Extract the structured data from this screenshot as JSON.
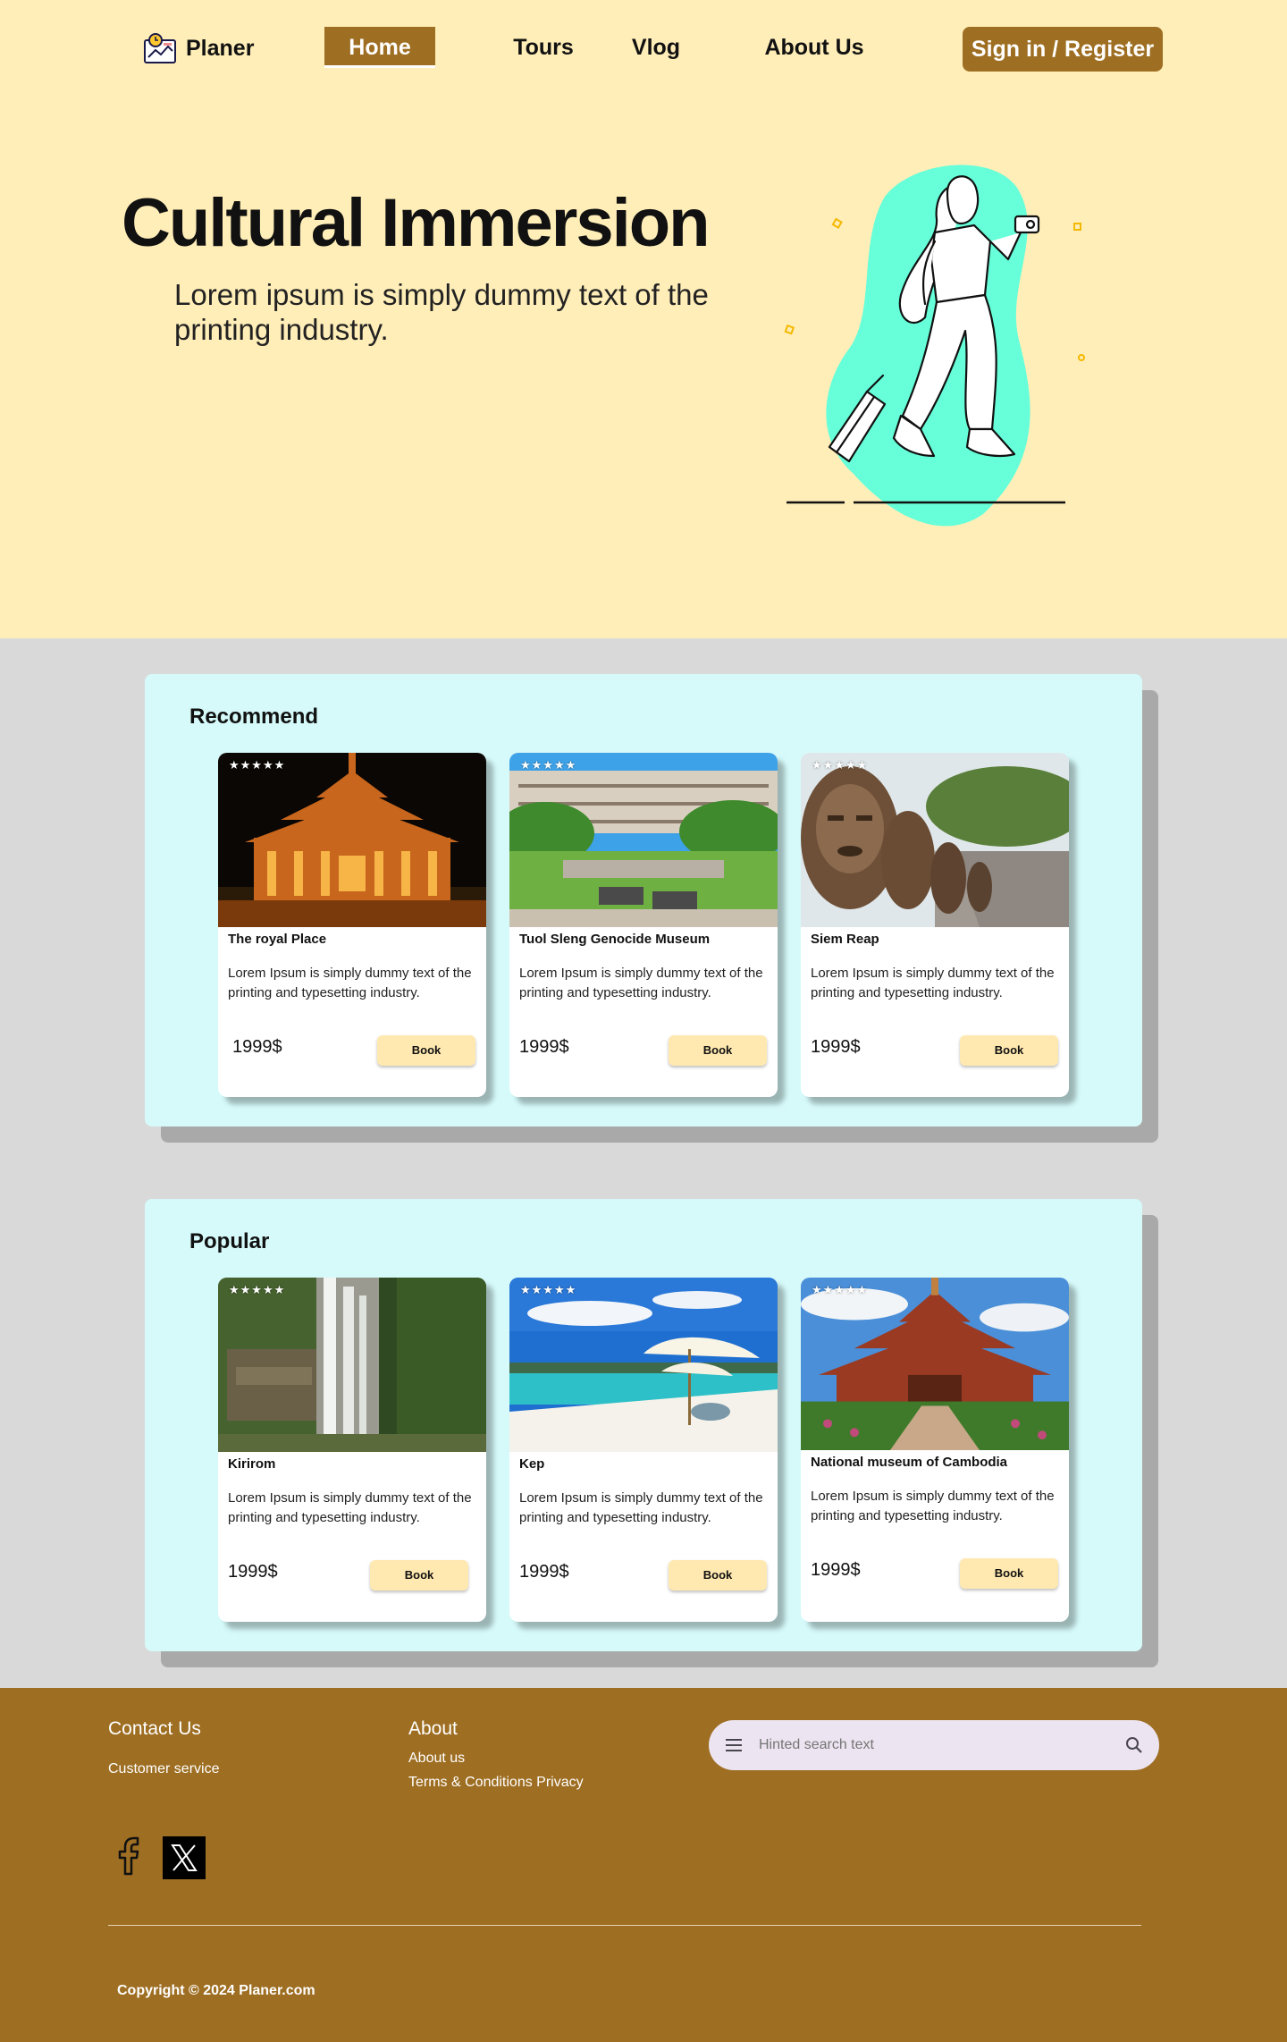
{
  "nav": {
    "brand": "Planer",
    "items": [
      "Home",
      "Tours",
      "Vlog",
      "About Us"
    ],
    "active": "Home",
    "signin": "Sign in / Register"
  },
  "hero": {
    "title": "Cultural Immersion",
    "subtitle": "Lorem ipsum is simply dummy text of the printing industry."
  },
  "recommend": {
    "title": "Recommend",
    "cards": [
      {
        "stars": "★★★★★",
        "name": "The royal Place",
        "desc": "Lorem Ipsum is simply dummy text of the printing and typesetting industry.",
        "price": "1999$",
        "book": "Book"
      },
      {
        "stars": "★★★★★",
        "name": "Tuol Sleng Genocide Museum",
        "desc": "Lorem Ipsum is simply dummy text of the printing and typesetting industry.",
        "price": "1999$",
        "book": "Book"
      },
      {
        "stars": "★★★★★",
        "name": "Siem Reap",
        "desc": "Lorem Ipsum is simply dummy text of the printing and typesetting industry.",
        "price": "1999$",
        "book": "Book"
      }
    ]
  },
  "popular": {
    "title": "Popular",
    "cards": [
      {
        "stars": "★★★★★",
        "name": "Kirirom",
        "desc": "Lorem Ipsum is simply dummy text of the printing and typesetting industry.",
        "price": "1999$",
        "book": "Book"
      },
      {
        "stars": "★★★★★",
        "name": "Kep",
        "desc": "Lorem Ipsum is simply dummy text of the printing and typesetting industry.",
        "price": "1999$",
        "book": "Book"
      },
      {
        "stars": "★★★★★",
        "name": "National museum of Cambodia",
        "desc": "Lorem Ipsum is simply dummy text of the printing and typesetting industry.",
        "price": "1999$",
        "book": "Book"
      }
    ]
  },
  "footer": {
    "contact_title": "Contact Us",
    "contact_links": [
      "Customer service"
    ],
    "about_title": "About",
    "about_links": [
      "About us",
      "Terms & Conditions Privacy"
    ],
    "search_placeholder": "Hinted search text",
    "copyright": "Copyright © 2024 Planer.com"
  },
  "colors": {
    "page_bg": "#ffeeb8",
    "brand_brown": "#9e6e22",
    "section_bg": "#d6fafa",
    "band_bg": "#d9d9d9",
    "book_bg": "#ffe9b0",
    "illustration_blob": "#66ffd9"
  },
  "icons": [
    "logo-icon",
    "menu-icon",
    "search-icon",
    "facebook-icon",
    "x-icon"
  ]
}
